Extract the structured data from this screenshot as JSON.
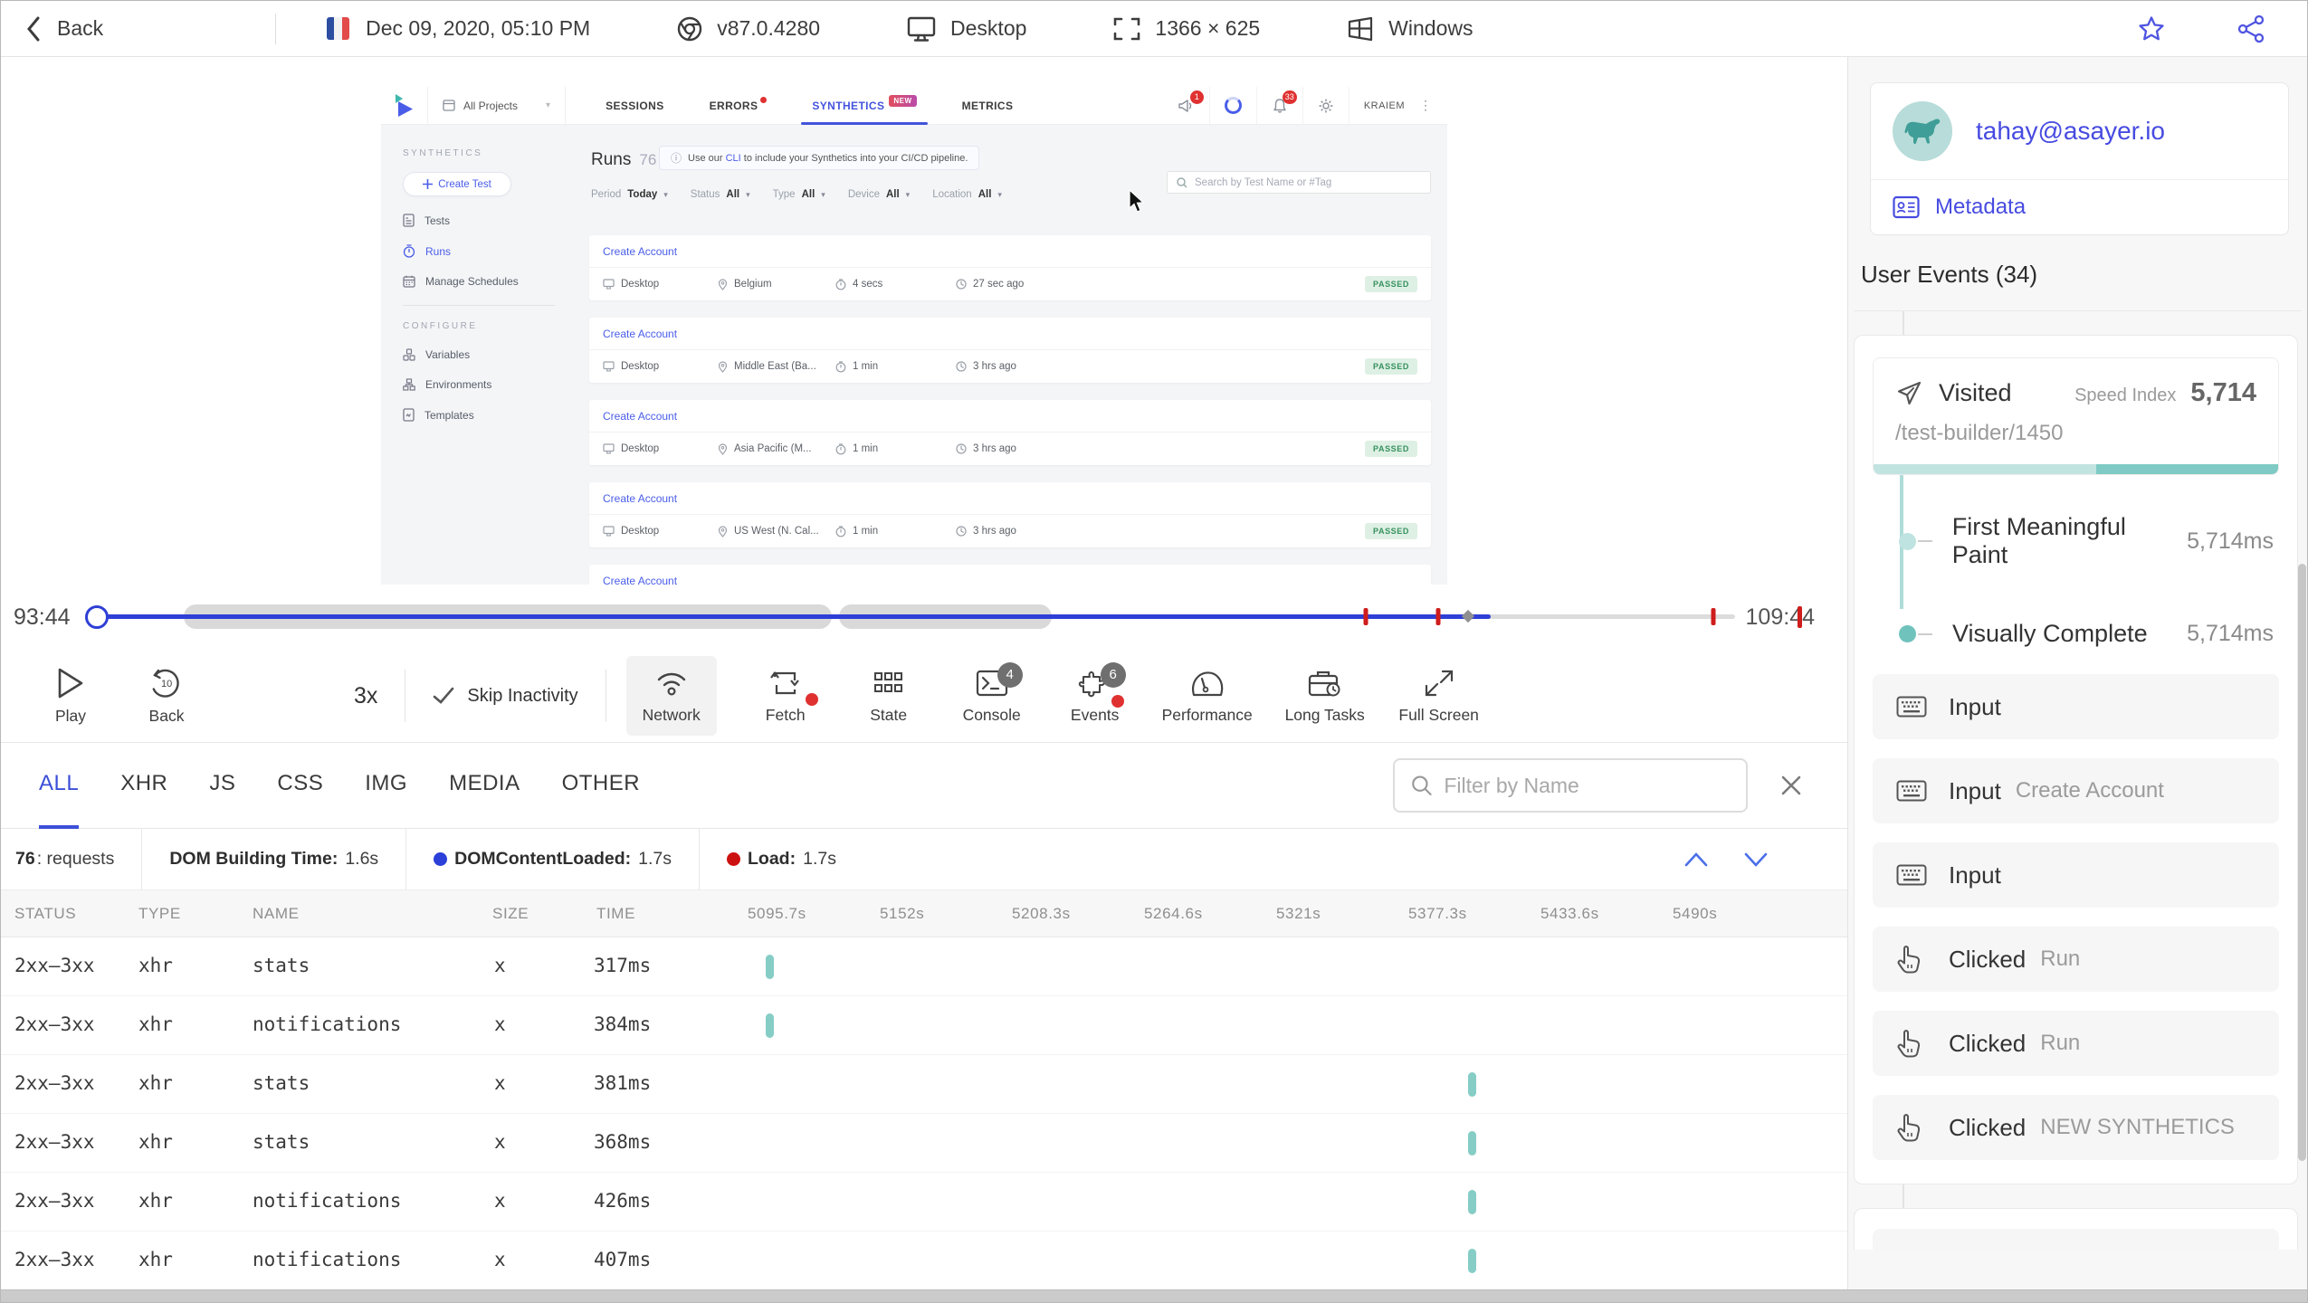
{
  "topbar": {
    "back_label": "Back",
    "date": "Dec 09, 2020, 05:10 PM",
    "browser_version": "v87.0.4280",
    "device": "Desktop",
    "resolution": "1366 × 625",
    "os": "Windows"
  },
  "replay_app": {
    "nav": {
      "project": "All Projects",
      "tab_sessions": "SESSIONS",
      "tab_errors": "ERRORS",
      "tab_synthetics": "SYNTHETICS",
      "synthetics_badge": "NEW",
      "tab_metrics": "METRICS",
      "announce_badge": "1",
      "bell_badge": "33",
      "user": "KRAIEM"
    },
    "sidebar": {
      "section_synthetics": "SYNTHETICS",
      "create_test": "Create Test",
      "tests": "Tests",
      "runs": "Runs",
      "manage_schedules": "Manage Schedules",
      "section_configure": "CONFIGURE",
      "variables": "Variables",
      "environments": "Environments",
      "templates": "Templates"
    },
    "header": {
      "title": "Runs",
      "count": "76",
      "banner_info": "ⓘ",
      "banner_pre": "Use our",
      "banner_cli": "CLI",
      "banner_post": "to include your Synthetics into your CI/CD pipeline."
    },
    "filters": {
      "period_label": "Period",
      "period_value": "Today",
      "status_label": "Status",
      "status_value": "All",
      "type_label": "Type",
      "type_value": "All",
      "device_label": "Device",
      "device_value": "All",
      "location_label": "Location",
      "location_value": "All",
      "search_placeholder": "Search by Test Name or #Tag"
    },
    "runs": [
      {
        "name": "Create Account",
        "device": "Desktop",
        "location": "Belgium",
        "duration": "4 secs",
        "ago": "27 sec ago",
        "status": "PASSED"
      },
      {
        "name": "Create Account",
        "device": "Desktop",
        "location": "Middle East (Ba...",
        "duration": "1 min",
        "ago": "3 hrs ago",
        "status": "PASSED"
      },
      {
        "name": "Create Account",
        "device": "Desktop",
        "location": "Asia Pacific (M...",
        "duration": "1 min",
        "ago": "3 hrs ago",
        "status": "PASSED"
      },
      {
        "name": "Create Account",
        "device": "Desktop",
        "location": "US West (N. Cal...",
        "duration": "1 min",
        "ago": "3 hrs ago",
        "status": "PASSED"
      },
      {
        "name": "Create Account"
      }
    ]
  },
  "timeline": {
    "current": "93:44",
    "total": "109:44"
  },
  "controls": {
    "play": "Play",
    "back": "Back",
    "back_seconds": "10",
    "speed": "3x",
    "skip": "Skip Inactivity",
    "network": "Network",
    "fetch": "Fetch",
    "state": "State",
    "console": "Console",
    "console_badge": "4",
    "events": "Events",
    "events_badge": "6",
    "performance": "Performance",
    "long_tasks": "Long Tasks",
    "full_screen": "Full Screen"
  },
  "network": {
    "tabs": [
      "ALL",
      "XHR",
      "JS",
      "CSS",
      "IMG",
      "MEDIA",
      "OTHER"
    ],
    "active_tab": "ALL",
    "filter_placeholder": "Filter by Name",
    "summary": {
      "requests_count": "76",
      "requests_label": ": requests",
      "dom_building_label": "DOM Building Time:",
      "dom_building_value": "1.6s",
      "dcl_label": "DOMContentLoaded:",
      "dcl_value": "1.7s",
      "load_label": "Load:",
      "load_value": "1.7s",
      "dcl_color": "#2b3fd9",
      "load_color": "#cc1111"
    },
    "columns": [
      "STATUS",
      "TYPE",
      "NAME",
      "SIZE",
      "TIME"
    ],
    "time_columns": [
      "5095.7s",
      "5152s",
      "5208.3s",
      "5264.6s",
      "5321s",
      "5377.3s",
      "5433.6s",
      "5490s"
    ],
    "rows": [
      {
        "status": "2xx–3xx",
        "type": "xhr",
        "name": "stats",
        "size": "x",
        "time": "317ms",
        "bar_pct": 2.4
      },
      {
        "status": "2xx–3xx",
        "type": "xhr",
        "name": "notifications",
        "size": "x",
        "time": "384ms",
        "bar_pct": 2.4
      },
      {
        "status": "2xx–3xx",
        "type": "xhr",
        "name": "stats",
        "size": "x",
        "time": "381ms",
        "bar_pct": 68.8
      },
      {
        "status": "2xx–3xx",
        "type": "xhr",
        "name": "stats",
        "size": "x",
        "time": "368ms",
        "bar_pct": 68.8
      },
      {
        "status": "2xx–3xx",
        "type": "xhr",
        "name": "notifications",
        "size": "x",
        "time": "426ms",
        "bar_pct": 68.8
      },
      {
        "status": "2xx–3xx",
        "type": "xhr",
        "name": "notifications",
        "size": "x",
        "time": "407ms",
        "bar_pct": 68.8
      }
    ]
  },
  "user_panel": {
    "email": "tahay@asayer.io",
    "metadata_label": "Metadata",
    "events_title": "User Events (34)",
    "visited": {
      "label": "Visited",
      "speed_index_label": "Speed Index",
      "speed_index": "5,714",
      "url": "/test-builder/1450",
      "metrics": [
        {
          "label": "First Meaningful Paint",
          "value": "5,714ms"
        },
        {
          "label": "Visually Complete",
          "value": "5,714ms"
        }
      ]
    },
    "events": [
      {
        "icon": "keyboard",
        "action": "Input",
        "target": ""
      },
      {
        "icon": "keyboard",
        "action": "Input",
        "target": "Create Account"
      },
      {
        "icon": "keyboard",
        "action": "Input",
        "target": ""
      },
      {
        "icon": "pointer",
        "action": "Clicked",
        "target": "Run"
      },
      {
        "icon": "pointer",
        "action": "Clicked",
        "target": "Run"
      },
      {
        "icon": "pointer",
        "action": "Clicked",
        "target": "NEW SYNTHETICS"
      }
    ]
  }
}
